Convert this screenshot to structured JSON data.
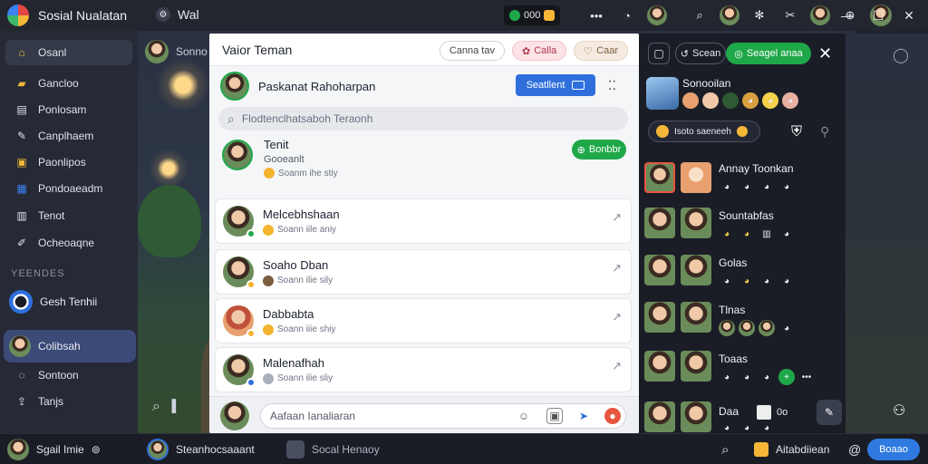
{
  "app": {
    "title": "Sosial Nualatan",
    "tab_label": "Wal",
    "coins": "000"
  },
  "titlebar": {
    "search_icon": "search-icon",
    "minimize": "—",
    "maximize": "☐",
    "close": "✕"
  },
  "sidebar": {
    "items": [
      {
        "label": "Osanl",
        "icon": "home-icon",
        "color": "#f5b638"
      },
      {
        "label": "Gancloo",
        "icon": "folder-icon",
        "color": "#f5b638"
      },
      {
        "label": "Ponlosam",
        "icon": "document-icon",
        "color": "#cdd2dc"
      },
      {
        "label": "Canplhaem",
        "icon": "chat-icon",
        "color": "#cdd2dc"
      },
      {
        "label": "Paonlipos",
        "icon": "bag-icon",
        "color": "#f5b638"
      },
      {
        "label": "Pondoaeadm",
        "icon": "calendar-icon",
        "color": "#3b82f6"
      },
      {
        "label": "Tenot",
        "icon": "news-icon",
        "color": "#cdd2dc"
      },
      {
        "label": "Ocheoaqne",
        "icon": "tool-icon",
        "color": "#cdd2dc"
      }
    ],
    "section_title": "YEENDES",
    "friends": [
      {
        "name": "Gesh Tenhii"
      },
      {
        "name": "Colibsah"
      },
      {
        "name": "Sontoon"
      },
      {
        "name": "Tanjs"
      }
    ],
    "bottom_user": "Sgail Imie"
  },
  "background": {
    "header_text": "Sonno"
  },
  "modal": {
    "title": "Vaior Teman",
    "chips": [
      {
        "label": "Canna tav"
      },
      {
        "label": "Calla"
      },
      {
        "label": "Caar"
      }
    ],
    "me": {
      "name": "Paskanat Rahoharpan",
      "action_label": "Seatllent"
    },
    "search_placeholder": "Flodtenclhatsaboh Teraonh",
    "request": {
      "name": "Tenit",
      "sub": "Gooeanlt",
      "status": "Soanm ihe stiy",
      "action_label": "Bonbbr"
    },
    "friends": [
      {
        "name": "Melcebhshaan",
        "status": "Soann iile aniy",
        "badge": "#1fa84a"
      },
      {
        "name": "Soaho Dban",
        "status": "Soann ilie sily",
        "badge": "#f4b42e"
      },
      {
        "name": "Dabbabta",
        "status": "Soann iiie shiy",
        "badge": "#f4b42e"
      },
      {
        "name": "Malenafhah",
        "status": "Soann ilie sliy",
        "badge": "#2f6fdc"
      }
    ],
    "composer_placeholder": "Aafaan Ianaliaran"
  },
  "rpanel": {
    "top_pill": "Scean",
    "green_pill": "Seagel anaa",
    "profile_name": "Sonooilan",
    "find_label": "Isoto saeneeh",
    "rows": [
      {
        "name": "Annay Toonkan"
      },
      {
        "name": "Sountabfas"
      },
      {
        "name": "Golas"
      },
      {
        "name": "Tlnas"
      },
      {
        "name": "Toaas"
      },
      {
        "name": "Daa"
      }
    ],
    "counter": "0o"
  },
  "bottombar": {
    "item1": "Steanhocsaaant",
    "item2": "Socal Henaoy",
    "item3": "Aitabdiiean",
    "button": "Boaao"
  }
}
